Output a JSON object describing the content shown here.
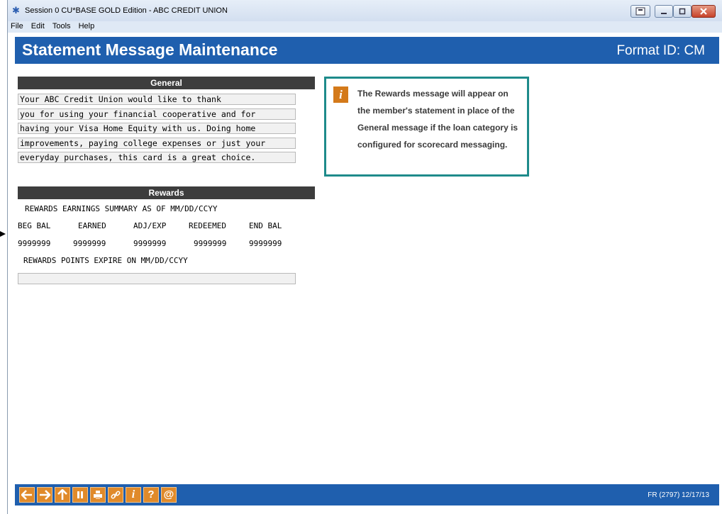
{
  "window": {
    "title": "Session 0 CU*BASE GOLD Edition - ABC CREDIT UNION",
    "app_icon": "asterisk-icon",
    "controls": {
      "help": "help-book-icon",
      "minimize": "minimize-icon",
      "maximize": "maximize-icon",
      "close": "close-icon"
    }
  },
  "menu": {
    "items": [
      "File",
      "Edit",
      "Tools",
      "Help"
    ]
  },
  "header": {
    "title": "Statement Message Maintenance",
    "format": "Format ID: CM",
    "color": "#1f5fae"
  },
  "general": {
    "heading": "General",
    "lines": [
      "Your ABC Credit Union would like to thank",
      "you for using your financial cooperative and for",
      "having your Visa Home Equity with us. Doing home",
      "improvements, paying college expenses or just your",
      "everyday purchases, this card is a great choice."
    ]
  },
  "rewards": {
    "heading": "Rewards",
    "summary": "REWARDS EARNINGS SUMMARY AS OF MM/DD/CCYY",
    "columns": [
      "BEG BAL",
      "EARNED",
      "ADJ/EXP",
      "REDEEMED",
      "END BAL"
    ],
    "values": [
      "9999999",
      "9999999",
      "9999999",
      "9999999",
      "9999999"
    ],
    "expire": "REWARDS POINTS EXPIRE ON MM/DD/CCYY",
    "extra_line": ""
  },
  "info": {
    "icon": "info-icon",
    "text": "The Rewards message will appear on the member's statement in place of the General message if the loan category is configured for scorecard messaging.",
    "border_color": "#1e8b8b"
  },
  "footer": {
    "buttons": [
      "back-arrow-icon",
      "forward-arrow-icon",
      "up-arrow-icon",
      "pause-icon",
      "print-icon",
      "link-icon",
      "info-icon",
      "help-icon",
      "email-icon"
    ],
    "code": "FR (2797) 12/17/13",
    "button_color": "#e08a2a"
  }
}
